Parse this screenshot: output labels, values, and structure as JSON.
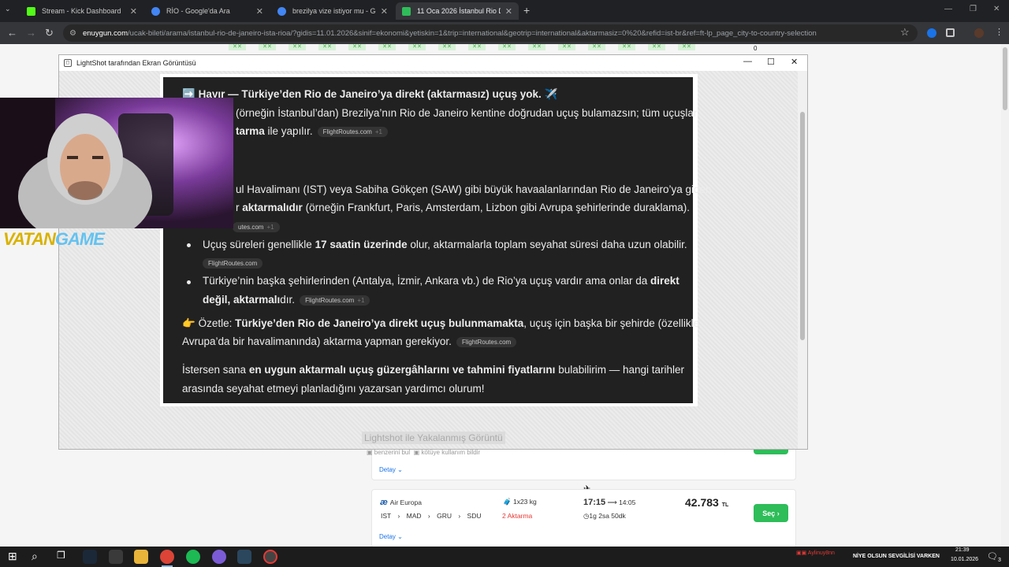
{
  "browser": {
    "tabs": [
      {
        "title": "Stream - Kick Dashboard",
        "icon": "kick-icon",
        "color": "#53fc18",
        "active": false
      },
      {
        "title": "RİO - Google'da Ara",
        "icon": "google-icon",
        "color": "#4285f4",
        "active": false
      },
      {
        "title": "brezilya vize istiyor mu - Google",
        "icon": "google-icon",
        "color": "#4285f4",
        "active": false
      },
      {
        "title": "11 Oca 2026 İstanbul Rio De Janeiro",
        "icon": "enuygun-icon",
        "color": "#2ebd59",
        "active": true
      }
    ],
    "new_tab": "+",
    "url_domain": "enuygun.com",
    "url_path": "/ucak-bileti/arama/istanbul-rio-de-janeiro-ista-rioa/?gidis=11.01.2026&sinif=ekonomi&yetiskin=1&trip=international&geotrip=international&aktarmasiz=0%20&refid=ist-br&ref=ft-lp_page_city-to-country-selection"
  },
  "page": {
    "flag_count": "0",
    "flag_label": "✕✕",
    "detay": "Detay ⌄",
    "flight": {
      "airline": "Air Europa",
      "route": [
        "IST",
        "MAD",
        "GRU",
        "SDU"
      ],
      "baggage": "1x23 kg",
      "stops": "2 Aktarma",
      "dep": "17:15",
      "arr": "14:05",
      "duration": "1g 2sa 50dk",
      "price": "42.783",
      "currency": "TL",
      "select": "Seç"
    }
  },
  "lightshot": {
    "window_title": "LightShot tarafından Ekran Görüntüsü",
    "footer_title": "Lightshot ile Yakalanmış Görüntü",
    "link_similar": "benzerini bul",
    "link_report": "kötüye kullanım bildir",
    "content": {
      "l1_icon": "➡️",
      "l1": "Hayır — Türkiye’den Rio de Janeiro’ya direkt (aktarmasız) uçuş yok.",
      "l1_plane": "✈️",
      "l2": "(örneğin İstanbul’dan) Brezilya’nın Rio de Janeiro kentine doğrudan uçuş bulamazsın; tüm uçuşlar",
      "l3_bold": "tarma",
      "l3": "ile yapılır.",
      "l4": "ul Havalimanı (IST) veya Sabiha Gökçen (SAW) gibi büyük havaalanlarından Rio de Janeiro’ya giden",
      "l5_pre": "r",
      "l5_bold": "aktarmalıdır",
      "l5": "(örneğin Frankfurt, Paris, Amsterdam, Lizbon gibi Avrupa şehirlerinde duraklama).",
      "l6_pre": "Uçuş süreleri genellikle",
      "l6_bold": "17 saatin üzerinde",
      "l6": "olur, aktarmalarla toplam seyahat süresi daha uzun olabilir.",
      "l7_pre": "Türkiye’nin başka şehirlerinden (Antalya, İzmir, Ankara vb.) de Rio’ya uçuş vardır ama onlar da",
      "l7_bold": "direkt",
      "l8_bold": "değil, aktarmalı",
      "l8": "dır.",
      "l9_icon": "👉",
      "l9_pre": "Özetle:",
      "l9_bold": "Türkiye’den Rio de Janeiro’ya direkt uçuş bulunmamakta",
      "l9": ", uçuş için başka bir şehirde (özellikle",
      "l10": "Avrupa’da bir havalimanında) aktarma yapman gerekiyor.",
      "l11_pre": "İstersen sana",
      "l11_bold": "en uygun aktarmalı uçuş güzergâhlarını ve tahmini fiyatlarını",
      "l11": "bulabilirim — hangi tarihler",
      "l12": "arasında seyahat etmeyi planladığını yazarsan yardımcı olurum!",
      "source": "FlightRoutes.com",
      "source_short": "utes.com",
      "plus": "+1"
    }
  },
  "overlay": {
    "brand_1": "VATAN",
    "brand_2": "GAME"
  },
  "taskbar": {
    "clock": "21:39",
    "date": "10.01.2026",
    "ticker_name": "Aylinuy8nn",
    "ticker": "NİYE OLSUN SEVGİLİSİ VARKEN",
    "notif": "3",
    "colors": {
      "accent": "#0078d4"
    }
  }
}
